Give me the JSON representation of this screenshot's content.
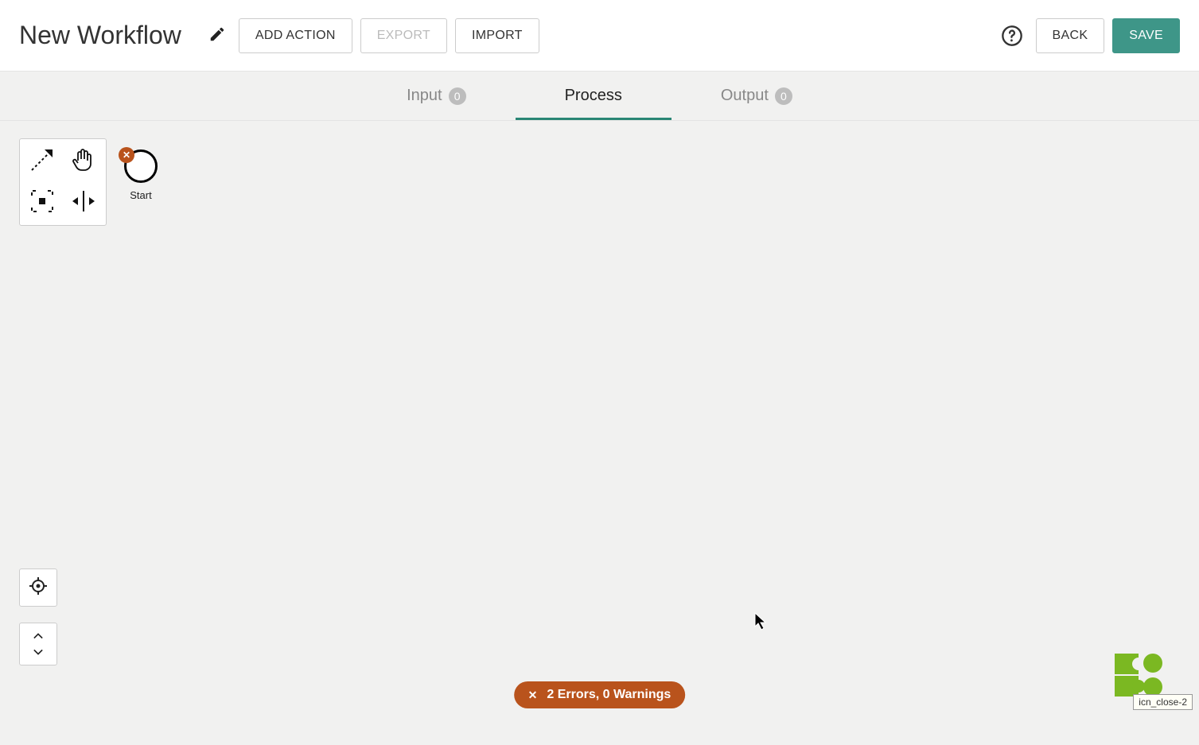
{
  "header": {
    "title": "New Workflow",
    "add_action_label": "ADD ACTION",
    "export_label": "EXPORT",
    "import_label": "IMPORT",
    "back_label": "BACK",
    "save_label": "SAVE"
  },
  "tabs": {
    "input": {
      "label": "Input",
      "count": "0"
    },
    "process": {
      "label": "Process"
    },
    "output": {
      "label": "Output",
      "count": "0"
    }
  },
  "canvas": {
    "start_node_label": "Start",
    "start_node_error_glyph": "✕"
  },
  "status": {
    "close_glyph": "✕",
    "message": "2 Errors, 0 Warnings"
  },
  "tooltip": {
    "text": "icn_close-2"
  }
}
